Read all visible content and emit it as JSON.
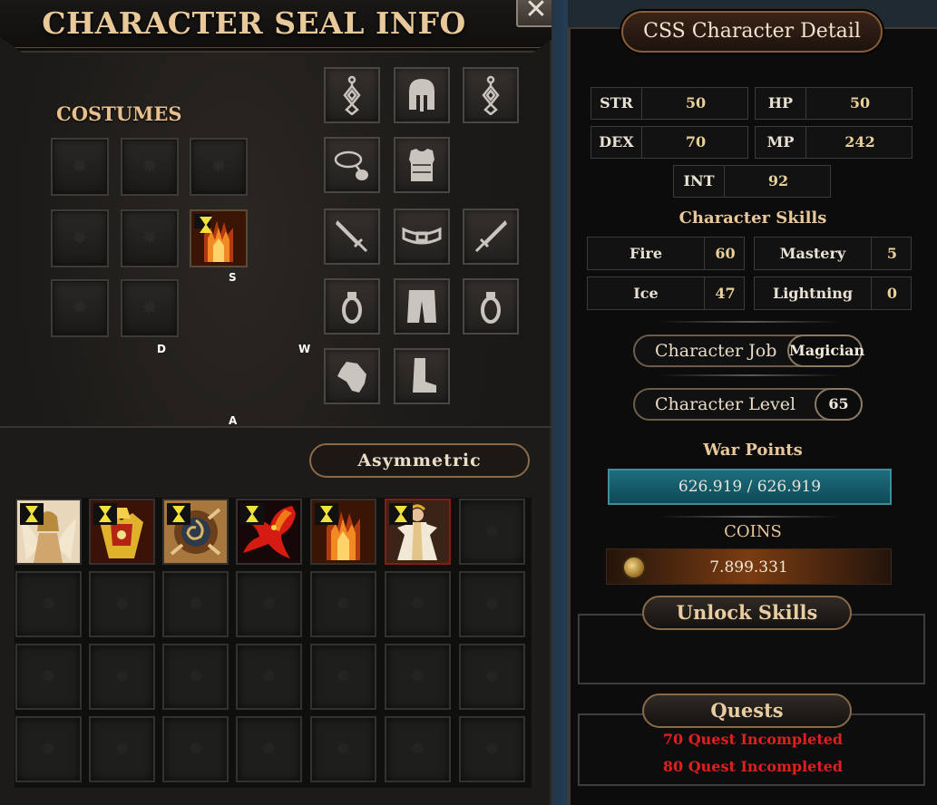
{
  "left": {
    "title": "CHARACTER SEAL INFO",
    "close_symbol": "✕",
    "costumes_label": "COSTUMES",
    "keys": {
      "s": "S",
      "d": "D",
      "w": "W",
      "a": "A"
    },
    "asymmetric_label": "Asymmetric",
    "equipment_slots": [
      "earring-left",
      "helmet",
      "earring-right",
      "necklace",
      "armor",
      "weapon-left",
      "belt",
      "weapon-right",
      "ring-left",
      "pants",
      "ring-right",
      "gloves",
      "boots"
    ],
    "inventory_items": [
      "fairy-costume",
      "golden-armor",
      "ornate-emblem",
      "phoenix-wings",
      "flame-gauntlet",
      "white-robe"
    ]
  },
  "right": {
    "title": "CSS Character Detail",
    "stats": [
      {
        "label": "STR",
        "value": "50"
      },
      {
        "label": "HP",
        "value": "50"
      },
      {
        "label": "DEX",
        "value": "70"
      },
      {
        "label": "MP",
        "value": "242"
      },
      {
        "label": "INT",
        "value": "92"
      }
    ],
    "skills_title": "Character Skills",
    "skills": [
      {
        "label": "Fire",
        "value": "60"
      },
      {
        "label": "Mastery",
        "value": "5"
      },
      {
        "label": "Ice",
        "value": "47"
      },
      {
        "label": "Lightning",
        "value": "0"
      }
    ],
    "job_label": "Character Job",
    "job_value": "Magician",
    "level_label": "Character Level",
    "level_value": "65",
    "war_points_title": "War Points",
    "war_points_value": "626.919 / 626.919",
    "coins_title": "COINS",
    "coins_value": "7.899.331",
    "unlock_skills_title": "Unlock Skills",
    "quests_title": "Quests",
    "quests": [
      "70 Quest Incompleted",
      "80 Quest Incompleted"
    ]
  },
  "colors": {
    "title_gold": "#e9c89a",
    "quest_red": "#e0201e",
    "war_bar": "#1d6e7e",
    "hourglass_yellow": "#f2e13a"
  }
}
